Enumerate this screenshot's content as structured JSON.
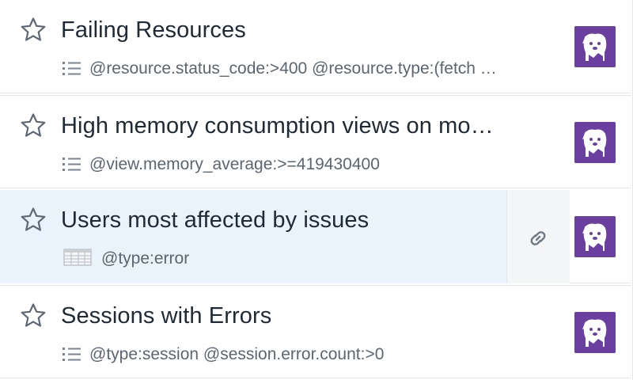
{
  "monitors": [
    {
      "title": "Failing Resources",
      "query": "@resource.status_code:>400 @resource.type:(fetch …",
      "query_icon": "list-icon",
      "starred": false
    },
    {
      "title": "High memory consumption views on mo…",
      "query": "@view.memory_average:>=419430400",
      "query_icon": "list-icon",
      "starred": false
    },
    {
      "title": "Users most affected by issues",
      "query": "@type:error",
      "query_icon": "table-icon",
      "starred": false,
      "selected": true
    },
    {
      "title": "Sessions with Errors",
      "query": "@type:session @session.error.count:>0",
      "query_icon": "list-icon",
      "starred": false
    }
  ],
  "colors": {
    "brand_purple": "#6b3fa0",
    "selected_bg": "#eaf3fb",
    "text_primary": "#1e2a35",
    "text_secondary": "#5b6670",
    "icon_gray": "#7a8590"
  },
  "icons": {
    "star": "star-outline-icon",
    "link": "link-icon",
    "avatar": "datadog-logo-avatar"
  }
}
